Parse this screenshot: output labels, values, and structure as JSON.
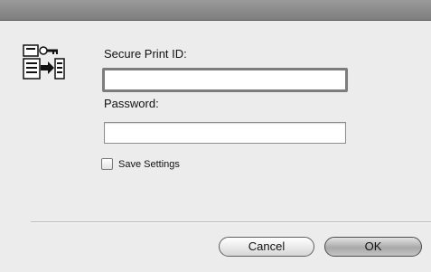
{
  "dialog": {
    "app_icon": "secure-print-icon",
    "secure_print_id_label": "Secure Print ID:",
    "secure_print_id_value": "",
    "password_label": "Password:",
    "password_value": "",
    "save_settings_label": "Save Settings",
    "save_settings_checked": false,
    "cancel_label": "Cancel",
    "ok_label": "OK"
  }
}
